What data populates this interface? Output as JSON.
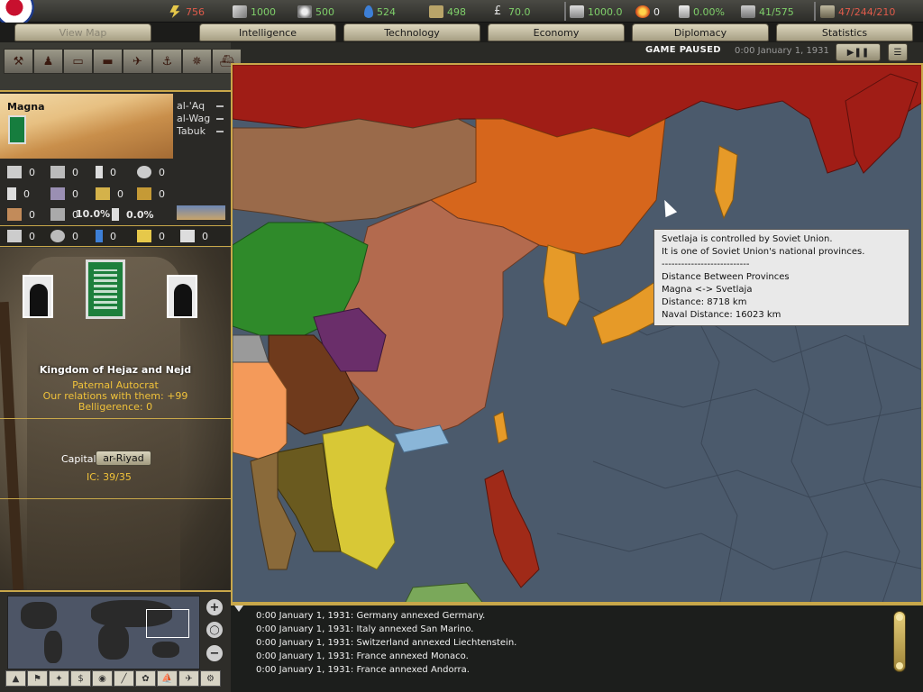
{
  "resources": [
    {
      "name": "energy",
      "icon": "energy-icon",
      "value": "756",
      "color": "#e05b4b"
    },
    {
      "name": "metal",
      "icon": "metal-icon",
      "value": "1000",
      "color": "#7fd06a"
    },
    {
      "name": "rare_materials",
      "icon": "rare-materials-icon",
      "value": "500",
      "color": "#7fd06a"
    },
    {
      "name": "oil",
      "icon": "oil-icon",
      "value": "524",
      "color": "#7fd06a"
    },
    {
      "name": "supplies",
      "icon": "supplies-icon",
      "value": "498",
      "color": "#7fd06a"
    },
    {
      "name": "money",
      "icon": "money-icon",
      "value": "70.0",
      "color": "#7fd06a"
    },
    {
      "name": "manpower",
      "icon": "manpower-icon",
      "value": "1000.0",
      "color": "#7fd06a"
    },
    {
      "name": "nukes",
      "icon": "nuke-icon",
      "value": "0",
      "color": "#f0f0f0"
    },
    {
      "name": "dissent",
      "icon": "dissent-icon",
      "value": "0.00%",
      "color": "#7fd06a"
    },
    {
      "name": "transport",
      "icon": "transport-icon",
      "value": "41/575",
      "color": "#7fd06a"
    },
    {
      "name": "convoys",
      "icon": "convoy-icon",
      "value": "47/244/210",
      "color": "#e05b4b"
    }
  ],
  "tabs": [
    {
      "label": "View Map",
      "disabled": true
    },
    {
      "label": "Intelligence",
      "disabled": false
    },
    {
      "label": "Technology",
      "disabled": false
    },
    {
      "label": "Economy",
      "disabled": false
    },
    {
      "label": "Diplomacy",
      "disabled": false
    },
    {
      "label": "Statistics",
      "disabled": false
    }
  ],
  "status": {
    "paused": "GAME PAUSED",
    "date": "0:00 January 1, 1931"
  },
  "province": {
    "name": "Magna",
    "neighbors": [
      "al-'Aq",
      "al-Wag",
      "Tabuk"
    ],
    "stats_row1": [
      "0",
      "0",
      "0",
      "0"
    ],
    "stats_row2": [
      "0",
      "0",
      "0",
      "0"
    ],
    "stats_row3": [
      "0",
      "0",
      "10.0%",
      "0.0%"
    ],
    "resource_row": [
      "0",
      "0",
      "0",
      "0",
      "0"
    ]
  },
  "country": {
    "name": "Kingdom of Hejaz and Nejd",
    "government": "Paternal Autocrat",
    "relations": "Our relations with them: +99",
    "belligerence": "Belligerence: 0",
    "capital_label": "Capital:",
    "capital": "ar-Riyad",
    "ic": "IC: 39/35",
    "flag_color": "#1d7f3c"
  },
  "tooltip": {
    "line1": "Svetlaja is controlled by Soviet Union.",
    "line2": "It is one of Soviet Union's national provinces.",
    "line3": "---------------------------",
    "line4": "Distance Between Provinces",
    "line5": "Magna <-> Svetlaja",
    "line6": "Distance: 8718 km",
    "line7": "Naval Distance: 16023 km"
  },
  "log": [
    "0:00 January 1, 1931: Germany annexed Germany.",
    "0:00 January 1, 1931: Italy annexed San Marino.",
    "0:00 January 1, 1931: Switzerland annexed Liechtenstein.",
    "0:00 January 1, 1931: France annexed Monaco.",
    "0:00 January 1, 1931: France annexed Andorra."
  ],
  "map_colors": {
    "soviet": "#a01d16",
    "mongolia": "#9a6a4a",
    "manchukuo": "#d6661c",
    "china": "#b36a4e",
    "xinjiang": "#2f8a2a",
    "tibet": "#6f3a1c",
    "japan": "#e69a28",
    "siam": "#6a5a1f",
    "indochina": "#d8c836",
    "philippines": "#a02a18",
    "ocean": "#4b5a6c"
  }
}
